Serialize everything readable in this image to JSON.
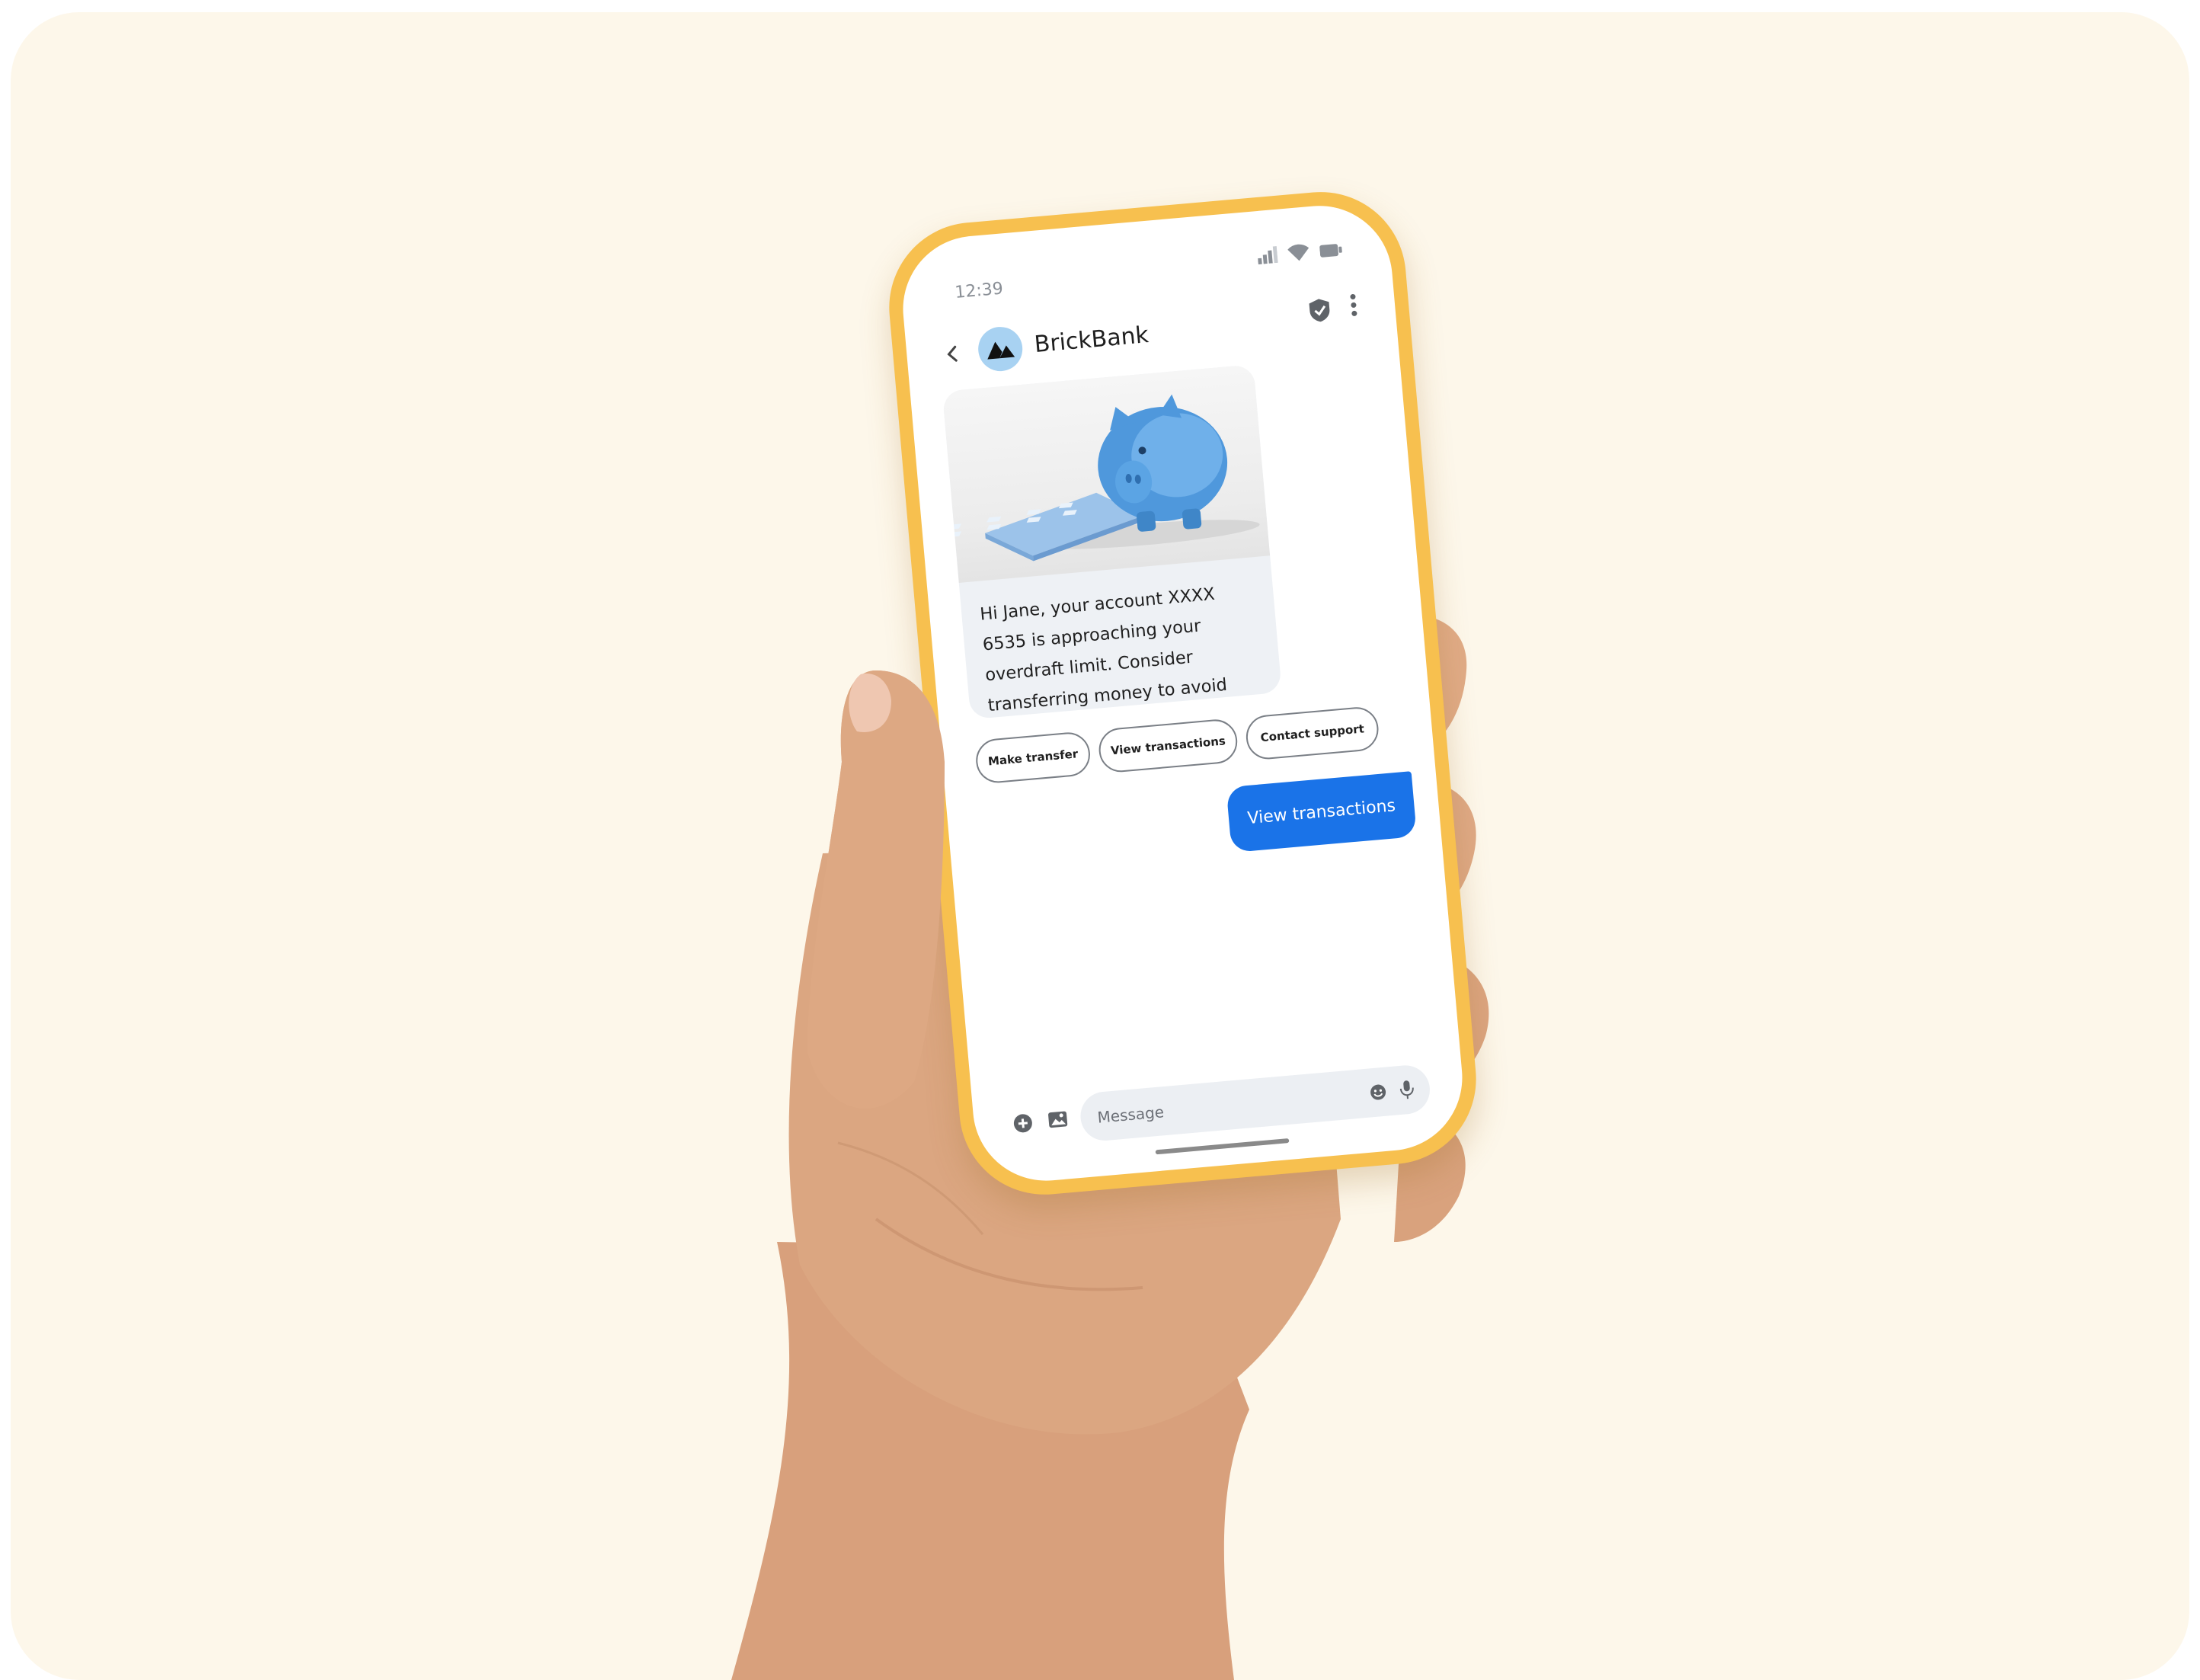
{
  "status_bar": {
    "time": "12:39"
  },
  "header": {
    "brand_name": "BrickBank"
  },
  "message": {
    "text": "Hi Jane, your account XXXX 6535 is approaching your overdraft limit. Consider transferring money to avoid fees."
  },
  "suggestions": [
    {
      "label": "Make transfer"
    },
    {
      "label": "View transactions"
    },
    {
      "label": "Contact support"
    }
  ],
  "sent_message": {
    "text": "View transactions"
  },
  "composer": {
    "placeholder": "Message"
  },
  "icons": {
    "back": "chevron-left-icon",
    "brand_logo": "brickbank-logo",
    "verified": "shield-check-icon",
    "more": "more-vert-icon",
    "signal": "signal-icon",
    "wifi": "wifi-icon",
    "battery": "battery-icon",
    "add": "add-circle-icon",
    "gallery": "image-icon",
    "emoji": "emoji-icon",
    "mic": "mic-icon"
  },
  "colors": {
    "background": "#fdf7ea",
    "phone_frame": "#f7c04f",
    "accent_blue": "#1a73e8",
    "avatar_bg": "#a8d2f2",
    "bubble_bg": "#eef1f5",
    "skin": "#d9a27f"
  }
}
